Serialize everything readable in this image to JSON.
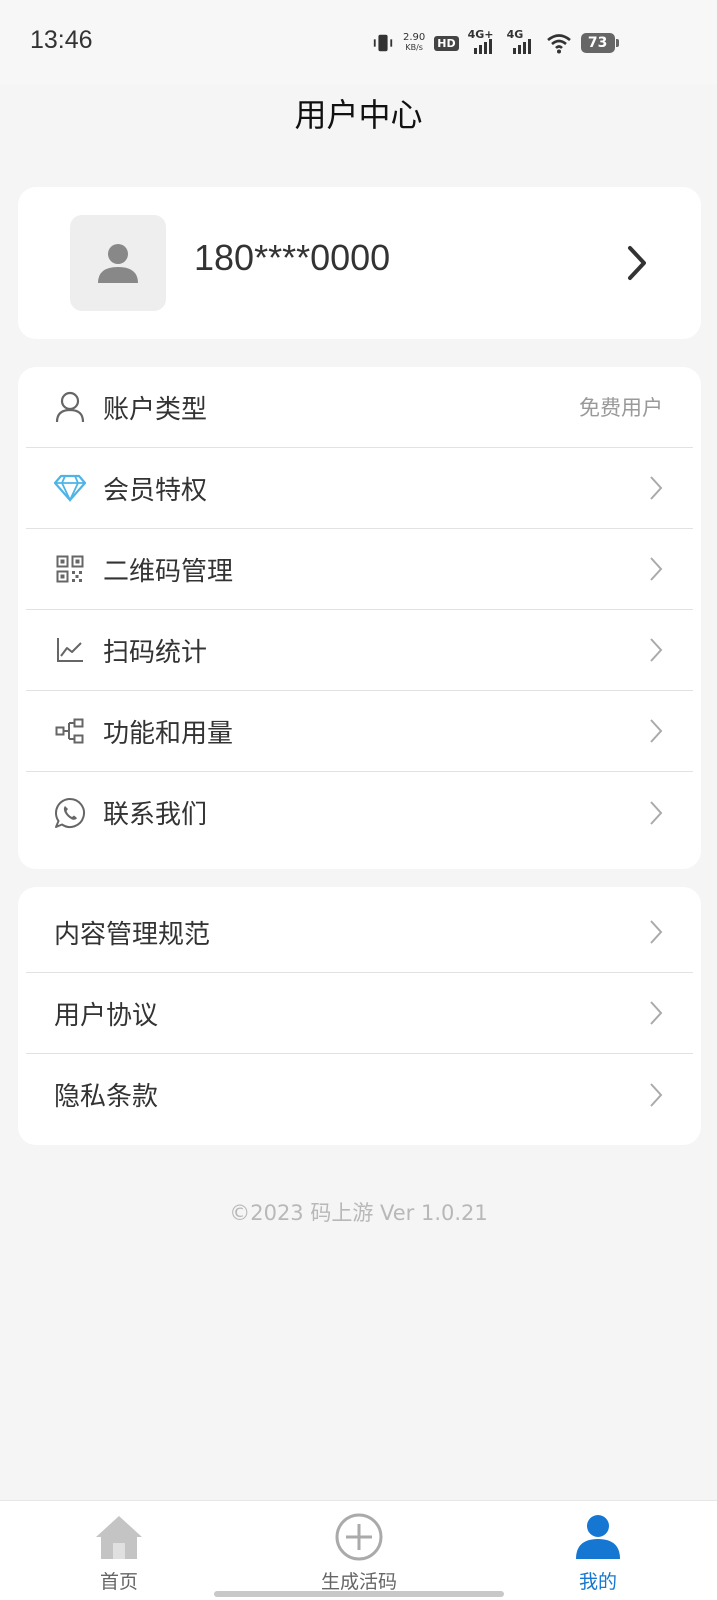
{
  "status_bar": {
    "time": "13:46",
    "net_speed_value": "2.90",
    "net_speed_unit": "KB/s",
    "hd_label": "HD",
    "sim1_network": "4G+",
    "sim2_network": "4G",
    "battery_level": "73"
  },
  "header": {
    "title": "用户中心"
  },
  "profile": {
    "phone": "180****0000"
  },
  "menu": {
    "account_type_label": "账户类型",
    "account_type_value": "免费用户",
    "items": [
      {
        "label": "会员特权",
        "icon": "diamond-icon"
      },
      {
        "label": "二维码管理",
        "icon": "qr-code-icon"
      },
      {
        "label": "扫码统计",
        "icon": "line-chart-icon"
      },
      {
        "label": "功能和用量",
        "icon": "flow-diagram-icon"
      },
      {
        "label": "联系我们",
        "icon": "whatsapp-phone-icon"
      }
    ]
  },
  "legal": {
    "items": [
      {
        "label": "内容管理规范"
      },
      {
        "label": "用户协议"
      },
      {
        "label": "隐私条款"
      }
    ]
  },
  "footer": {
    "copyright": "©2023 码上游 Ver 1.0.21"
  },
  "bottom_nav": {
    "items": [
      {
        "label": "首页",
        "icon": "home-icon"
      },
      {
        "label": "生成活码",
        "icon": "plus-circle-icon"
      },
      {
        "label": "我的",
        "icon": "user-icon"
      }
    ],
    "active_index": 2
  },
  "colors": {
    "accent": "#1677d2",
    "diamond": "#4fb3e6",
    "background": "#f5f5f5",
    "card": "#ffffff"
  }
}
